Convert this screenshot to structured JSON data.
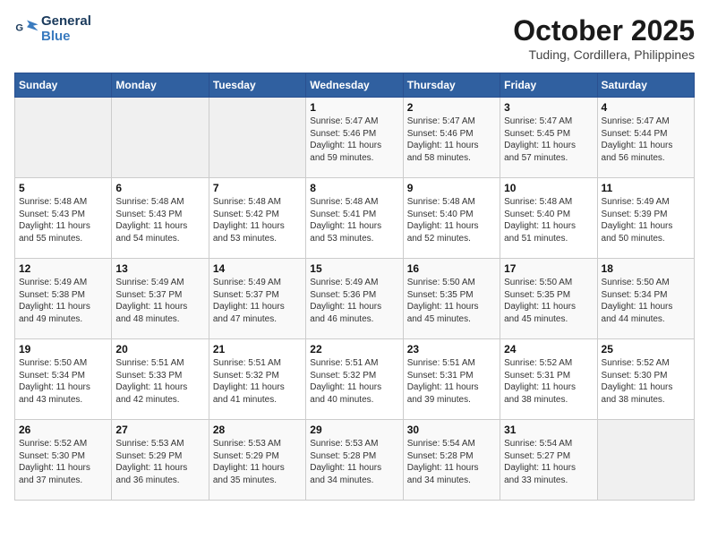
{
  "header": {
    "logo_line1": "General",
    "logo_line2": "Blue",
    "month": "October 2025",
    "location": "Tuding, Cordillera, Philippines"
  },
  "weekdays": [
    "Sunday",
    "Monday",
    "Tuesday",
    "Wednesday",
    "Thursday",
    "Friday",
    "Saturday"
  ],
  "weeks": [
    [
      {
        "day": "",
        "info": ""
      },
      {
        "day": "",
        "info": ""
      },
      {
        "day": "",
        "info": ""
      },
      {
        "day": "1",
        "info": "Sunrise: 5:47 AM\nSunset: 5:46 PM\nDaylight: 11 hours\nand 59 minutes."
      },
      {
        "day": "2",
        "info": "Sunrise: 5:47 AM\nSunset: 5:46 PM\nDaylight: 11 hours\nand 58 minutes."
      },
      {
        "day": "3",
        "info": "Sunrise: 5:47 AM\nSunset: 5:45 PM\nDaylight: 11 hours\nand 57 minutes."
      },
      {
        "day": "4",
        "info": "Sunrise: 5:47 AM\nSunset: 5:44 PM\nDaylight: 11 hours\nand 56 minutes."
      }
    ],
    [
      {
        "day": "5",
        "info": "Sunrise: 5:48 AM\nSunset: 5:43 PM\nDaylight: 11 hours\nand 55 minutes."
      },
      {
        "day": "6",
        "info": "Sunrise: 5:48 AM\nSunset: 5:43 PM\nDaylight: 11 hours\nand 54 minutes."
      },
      {
        "day": "7",
        "info": "Sunrise: 5:48 AM\nSunset: 5:42 PM\nDaylight: 11 hours\nand 53 minutes."
      },
      {
        "day": "8",
        "info": "Sunrise: 5:48 AM\nSunset: 5:41 PM\nDaylight: 11 hours\nand 53 minutes."
      },
      {
        "day": "9",
        "info": "Sunrise: 5:48 AM\nSunset: 5:40 PM\nDaylight: 11 hours\nand 52 minutes."
      },
      {
        "day": "10",
        "info": "Sunrise: 5:48 AM\nSunset: 5:40 PM\nDaylight: 11 hours\nand 51 minutes."
      },
      {
        "day": "11",
        "info": "Sunrise: 5:49 AM\nSunset: 5:39 PM\nDaylight: 11 hours\nand 50 minutes."
      }
    ],
    [
      {
        "day": "12",
        "info": "Sunrise: 5:49 AM\nSunset: 5:38 PM\nDaylight: 11 hours\nand 49 minutes."
      },
      {
        "day": "13",
        "info": "Sunrise: 5:49 AM\nSunset: 5:37 PM\nDaylight: 11 hours\nand 48 minutes."
      },
      {
        "day": "14",
        "info": "Sunrise: 5:49 AM\nSunset: 5:37 PM\nDaylight: 11 hours\nand 47 minutes."
      },
      {
        "day": "15",
        "info": "Sunrise: 5:49 AM\nSunset: 5:36 PM\nDaylight: 11 hours\nand 46 minutes."
      },
      {
        "day": "16",
        "info": "Sunrise: 5:50 AM\nSunset: 5:35 PM\nDaylight: 11 hours\nand 45 minutes."
      },
      {
        "day": "17",
        "info": "Sunrise: 5:50 AM\nSunset: 5:35 PM\nDaylight: 11 hours\nand 45 minutes."
      },
      {
        "day": "18",
        "info": "Sunrise: 5:50 AM\nSunset: 5:34 PM\nDaylight: 11 hours\nand 44 minutes."
      }
    ],
    [
      {
        "day": "19",
        "info": "Sunrise: 5:50 AM\nSunset: 5:34 PM\nDaylight: 11 hours\nand 43 minutes."
      },
      {
        "day": "20",
        "info": "Sunrise: 5:51 AM\nSunset: 5:33 PM\nDaylight: 11 hours\nand 42 minutes."
      },
      {
        "day": "21",
        "info": "Sunrise: 5:51 AM\nSunset: 5:32 PM\nDaylight: 11 hours\nand 41 minutes."
      },
      {
        "day": "22",
        "info": "Sunrise: 5:51 AM\nSunset: 5:32 PM\nDaylight: 11 hours\nand 40 minutes."
      },
      {
        "day": "23",
        "info": "Sunrise: 5:51 AM\nSunset: 5:31 PM\nDaylight: 11 hours\nand 39 minutes."
      },
      {
        "day": "24",
        "info": "Sunrise: 5:52 AM\nSunset: 5:31 PM\nDaylight: 11 hours\nand 38 minutes."
      },
      {
        "day": "25",
        "info": "Sunrise: 5:52 AM\nSunset: 5:30 PM\nDaylight: 11 hours\nand 38 minutes."
      }
    ],
    [
      {
        "day": "26",
        "info": "Sunrise: 5:52 AM\nSunset: 5:30 PM\nDaylight: 11 hours\nand 37 minutes."
      },
      {
        "day": "27",
        "info": "Sunrise: 5:53 AM\nSunset: 5:29 PM\nDaylight: 11 hours\nand 36 minutes."
      },
      {
        "day": "28",
        "info": "Sunrise: 5:53 AM\nSunset: 5:29 PM\nDaylight: 11 hours\nand 35 minutes."
      },
      {
        "day": "29",
        "info": "Sunrise: 5:53 AM\nSunset: 5:28 PM\nDaylight: 11 hours\nand 34 minutes."
      },
      {
        "day": "30",
        "info": "Sunrise: 5:54 AM\nSunset: 5:28 PM\nDaylight: 11 hours\nand 34 minutes."
      },
      {
        "day": "31",
        "info": "Sunrise: 5:54 AM\nSunset: 5:27 PM\nDaylight: 11 hours\nand 33 minutes."
      },
      {
        "day": "",
        "info": ""
      }
    ]
  ]
}
